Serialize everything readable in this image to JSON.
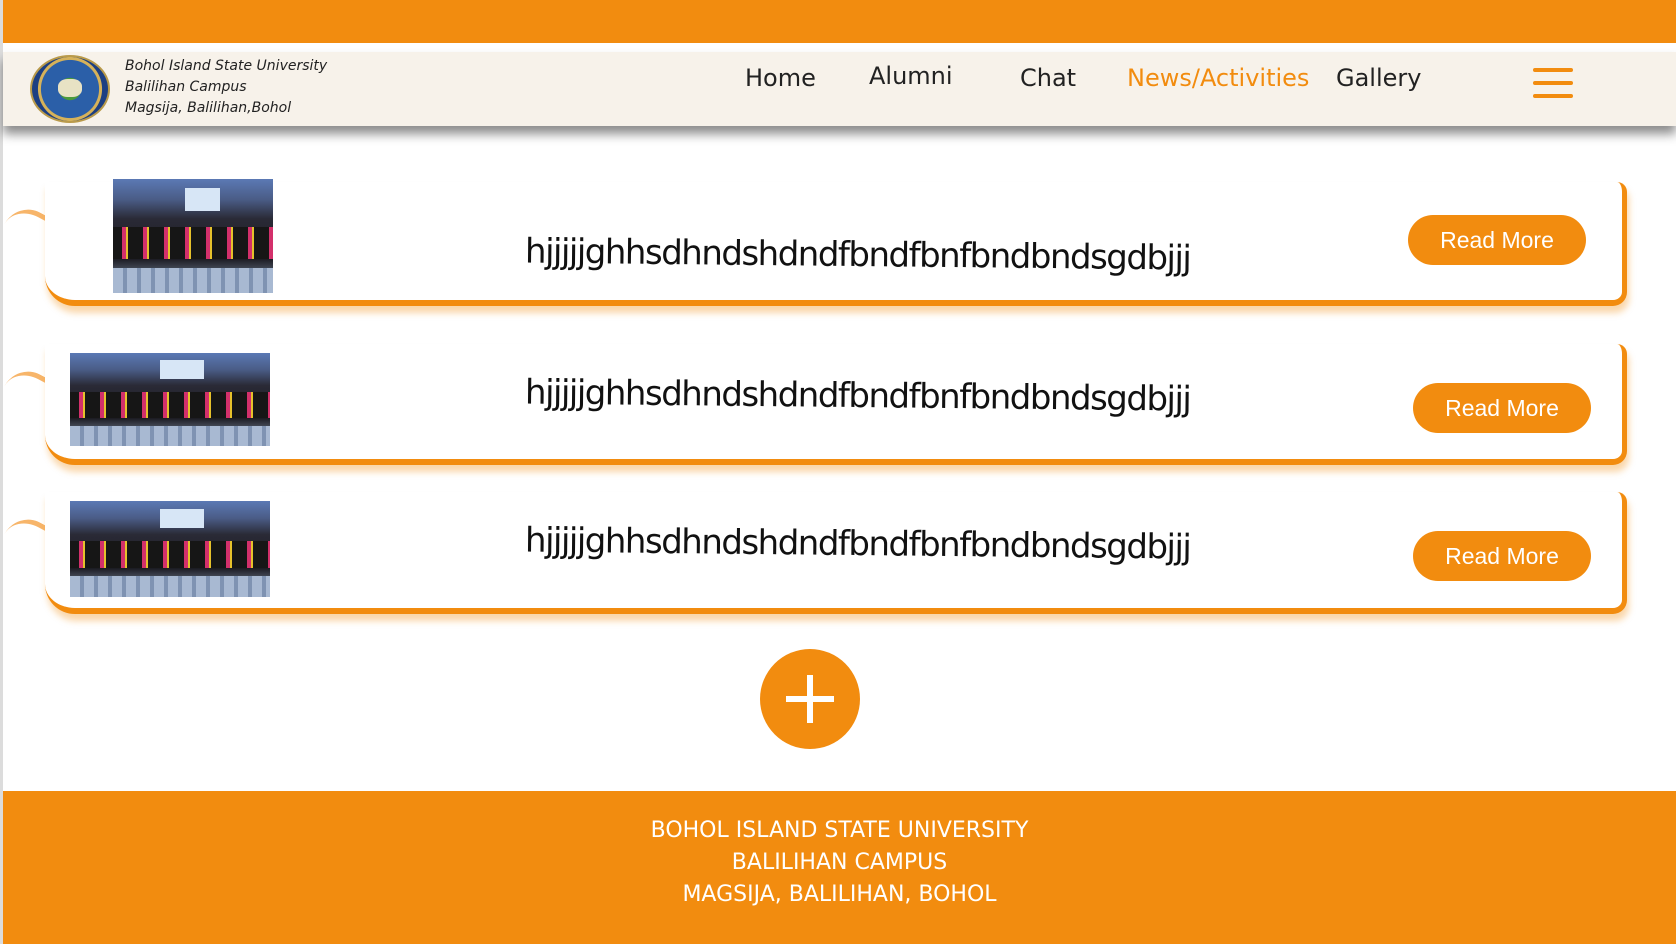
{
  "brand": {
    "line1": "Bohol Island State University",
    "line2": "Balilihan Campus",
    "line3": "Magsija, Balilihan,Bohol"
  },
  "nav": {
    "items": [
      {
        "label": "Home"
      },
      {
        "label": "Alumni"
      },
      {
        "label": "Chat"
      },
      {
        "label": "News/Activities",
        "active": true
      },
      {
        "label": "Gallery"
      }
    ],
    "menu_icon": "hamburger-menu-icon"
  },
  "news": {
    "items": [
      {
        "title": "hjjjjjghhsdhndshdndfbndfbnfbndbndsgdbjjj",
        "button": "Read More",
        "image": "graduation-ceremony-photo"
      },
      {
        "title": "hjjjjjghhsdhndshdndfbndfbnfbndbndsgdbjjj",
        "button": "Read More",
        "image": "graduation-ceremony-photo"
      },
      {
        "title": "hjjjjjghhsdhndshdndfbndfbnfbndbndsgdbjjj",
        "button": "Read More",
        "image": "graduation-ceremony-photo"
      }
    ],
    "add_icon": "plus-icon"
  },
  "footer": {
    "line1": "BOHOL ISLAND STATE UNIVERSITY",
    "line2": "BALILIHAN CAMPUS",
    "line3": "MAGSIJA, BALILIHAN, BOHOL"
  },
  "colors": {
    "accent": "#f28c0f",
    "header_bg": "#f7f2ea",
    "text": "#222222"
  }
}
